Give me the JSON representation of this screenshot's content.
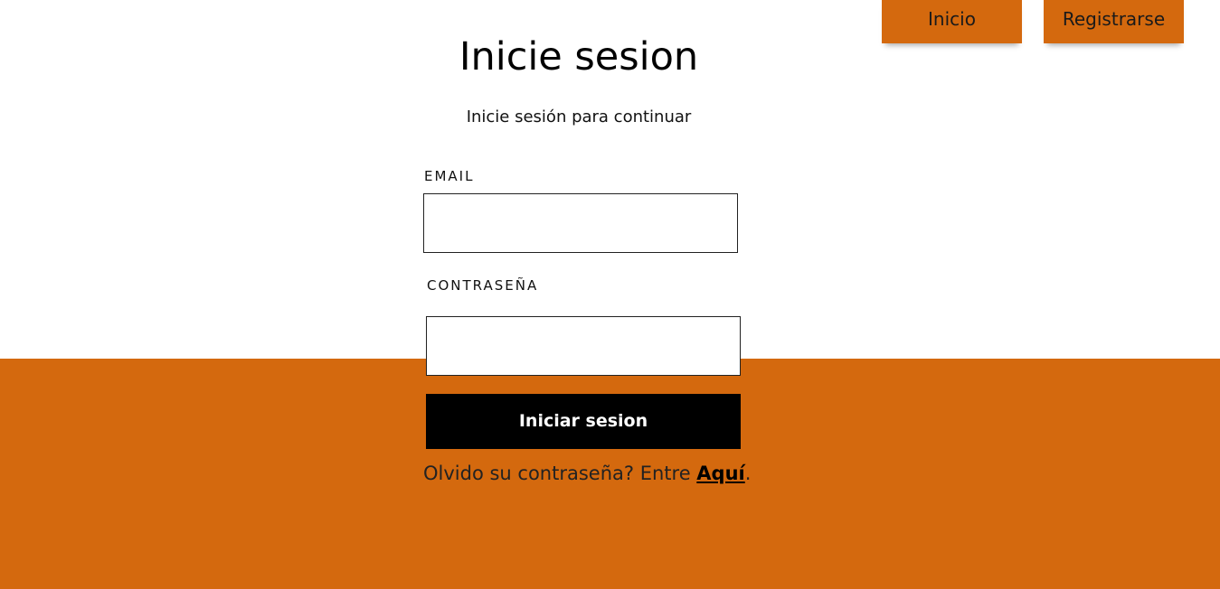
{
  "nav": {
    "inicio_label": "Inicio",
    "registrarse_label": "Registrarse"
  },
  "login": {
    "title": "Inicie sesion",
    "subtitle": "Inicie sesión para continuar",
    "email_label": "EMAIL",
    "email_value": "",
    "password_label": "CONTRASEÑA",
    "password_value": "",
    "submit_label": "Iniciar sesion",
    "forgot_prefix": "Olvido su contraseña? Entre ",
    "forgot_link": "Aquí",
    "forgot_suffix": "."
  },
  "colors": {
    "accent": "#d4690e",
    "button": "#000000",
    "background": "#ffffff"
  }
}
